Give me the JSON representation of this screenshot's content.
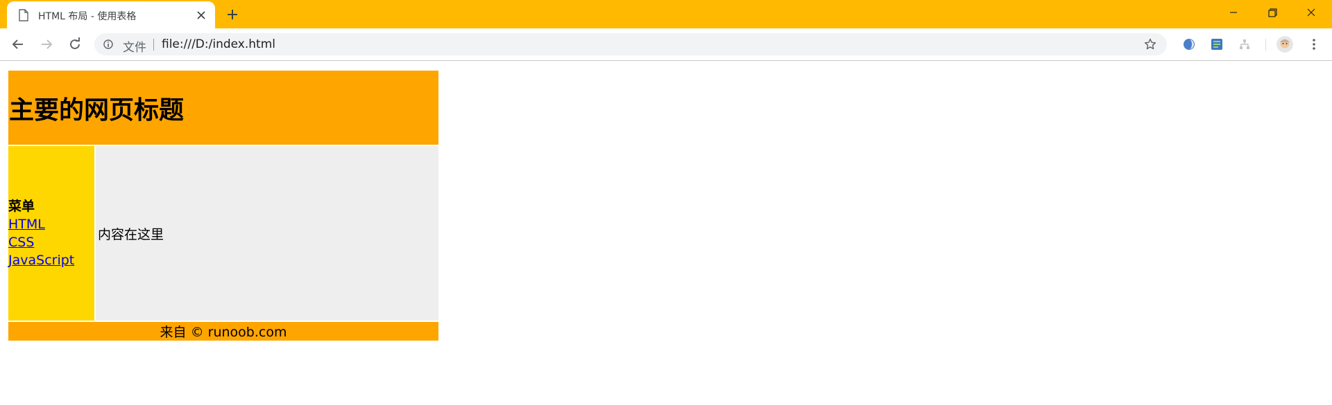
{
  "browser": {
    "tab": {
      "title": "HTML 布局 - 使用表格"
    },
    "omnibox": {
      "scheme_label": "文件",
      "url": "file:///D:/index.html"
    },
    "icons": {
      "page": "page-icon",
      "close": "close-icon",
      "new_tab": "plus-icon",
      "back": "arrow-left-icon",
      "forward": "arrow-right-icon",
      "reload": "reload-icon",
      "info": "info-icon",
      "star": "star-icon",
      "menu": "more-vert-icon"
    },
    "colors": {
      "frame": "#ffb900",
      "omnibox_bg": "#f1f3f4"
    }
  },
  "page": {
    "header": {
      "title": "主要的网页标题"
    },
    "menu": {
      "heading": "菜单",
      "links": [
        "HTML",
        "CSS",
        "JavaScript"
      ]
    },
    "main": {
      "text": "内容在这里"
    },
    "footer": {
      "text": "来自 © runoob.com"
    },
    "colors": {
      "header_bg": "#ffa500",
      "menu_bg": "#ffd700",
      "main_bg": "#eeeeee",
      "footer_bg": "#ffa500"
    }
  }
}
